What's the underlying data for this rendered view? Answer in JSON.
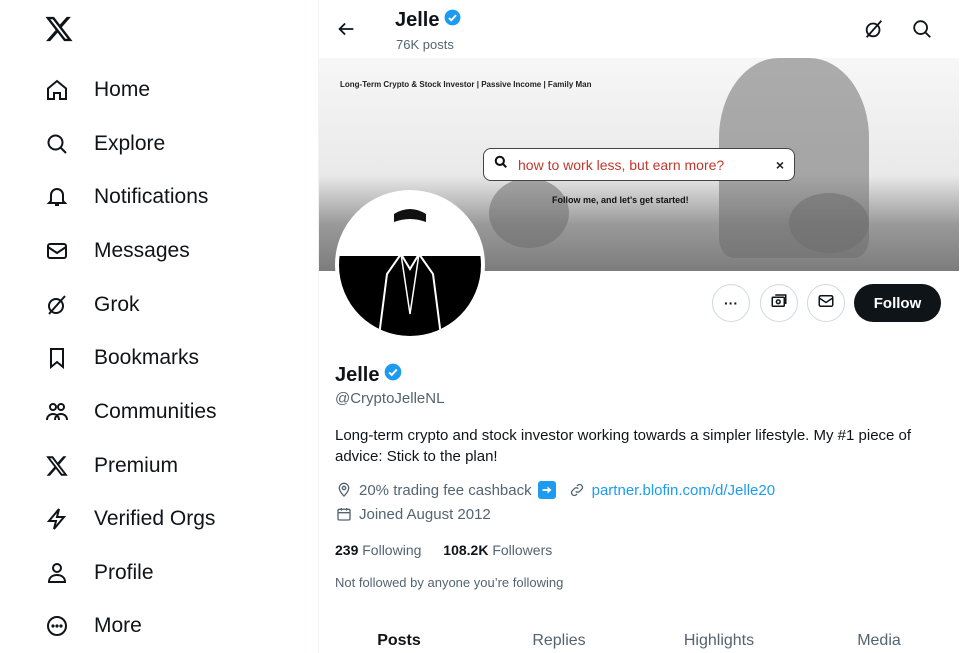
{
  "nav": {
    "items": [
      {
        "label": "Home",
        "icon": "home-icon"
      },
      {
        "label": "Explore",
        "icon": "search-icon"
      },
      {
        "label": "Notifications",
        "icon": "bell-icon"
      },
      {
        "label": "Messages",
        "icon": "envelope-icon"
      },
      {
        "label": "Grok",
        "icon": "grok-icon"
      },
      {
        "label": "Bookmarks",
        "icon": "bookmark-icon"
      },
      {
        "label": "Communities",
        "icon": "communities-icon"
      },
      {
        "label": "Premium",
        "icon": "x-logo-icon"
      },
      {
        "label": "Verified Orgs",
        "icon": "lightning-icon"
      },
      {
        "label": "Profile",
        "icon": "person-icon"
      },
      {
        "label": "More",
        "icon": "more-circle-icon"
      }
    ]
  },
  "header": {
    "name": "Jelle",
    "posts": "76K posts"
  },
  "banner": {
    "tagline": "Long-Term Crypto & Stock Investor | Passive Income | Family Man",
    "search_text": "how to work less, but earn more?",
    "close": "×",
    "subline": "Follow me, and let's get started!"
  },
  "profile": {
    "name": "Jelle",
    "handle": "@CryptoJelleNL",
    "bio": "Long-term crypto and stock investor working towards a simpler lifestyle. My #1 piece of advice: Stick to the plan!",
    "location": "20% trading fee cashback",
    "website": "partner.blofin.com/d/Jelle20",
    "joined": "Joined August 2012",
    "following_count": "239",
    "following_label": "Following",
    "followers_count": "108.2K",
    "followers_label": "Followers",
    "not_followed": "Not followed by anyone you’re following"
  },
  "actions": {
    "more": "···",
    "follow": "Follow"
  },
  "tabs": [
    "Posts",
    "Replies",
    "Highlights",
    "Media"
  ],
  "colors": {
    "accent": "#1d9bf0",
    "text": "#0f1419",
    "muted": "#536471"
  }
}
